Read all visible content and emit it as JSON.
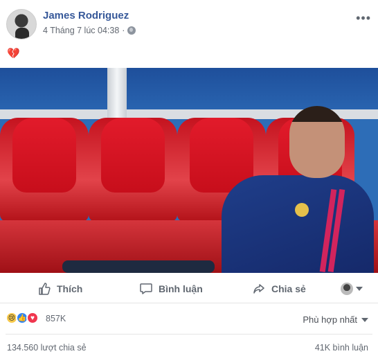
{
  "post": {
    "author": "James Rodriguez",
    "timestamp": "4 Tháng 7 lúc 04:38",
    "separator": "·",
    "privacy_icon": "globe-icon",
    "more_label": "•••",
    "text": "💔"
  },
  "photo": {
    "alt": "Player sitting on red stadium bench"
  },
  "actions": {
    "like": "Thích",
    "comment": "Bình luận",
    "share": "Chia sẻ"
  },
  "reactions": {
    "count": "857K",
    "sort": "Phù hợp nhất"
  },
  "footer": {
    "shares": "134.560 lượt chia sẻ",
    "comments": "41K bình luận"
  },
  "colors": {
    "author_link": "#365899",
    "meta_text": "#616770",
    "like_blue": "#2f84f4",
    "love_red": "#f0364e",
    "sad_yellow": "#f7c94b"
  }
}
